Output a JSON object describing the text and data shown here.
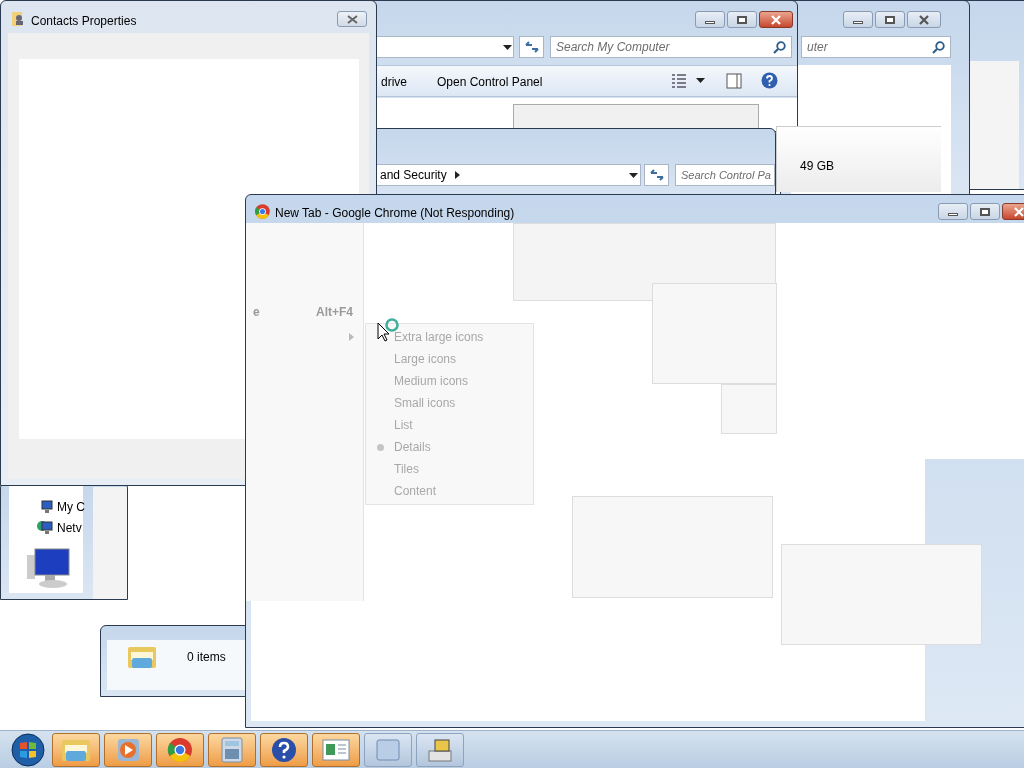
{
  "back_window": {
    "search_placeholder": "uter"
  },
  "explorer_window": {
    "search_placeholder": "Search My Computer",
    "toolbar": [
      "drive",
      "Open Control Panel"
    ]
  },
  "control_panel_window": {
    "breadcrumb": "and Security",
    "search_placeholder": "Search Control Pa"
  },
  "drive_panel": {
    "size": "49 GB"
  },
  "contacts_window": {
    "title": "Contacts Properties"
  },
  "nav_pane": {
    "items": [
      "My C",
      "Netv"
    ]
  },
  "folder_window": {
    "status": "0 items"
  },
  "chrome_window": {
    "title": "New Tab - Google Chrome (Not Responding)"
  },
  "context_menu": {
    "item": "e",
    "shortcut": "Alt+F4"
  },
  "view_menu": {
    "items": [
      {
        "label": "Extra large icons",
        "selected": false,
        "disabled": true
      },
      {
        "label": "Large icons",
        "selected": false,
        "disabled": true
      },
      {
        "label": "Medium icons",
        "selected": false,
        "disabled": true
      },
      {
        "label": "Small icons",
        "selected": false,
        "disabled": true
      },
      {
        "label": "List",
        "selected": false,
        "disabled": true
      },
      {
        "label": "Details",
        "selected": true,
        "disabled": true
      },
      {
        "label": "Tiles",
        "selected": false,
        "disabled": true
      },
      {
        "label": "Content",
        "selected": false,
        "disabled": true
      }
    ]
  },
  "taskbar": {
    "items": [
      {
        "kind": "folder",
        "running": true
      },
      {
        "kind": "media",
        "running": true
      },
      {
        "kind": "browser",
        "running": true
      },
      {
        "kind": "calculator",
        "running": true
      },
      {
        "kind": "help",
        "running": true
      },
      {
        "kind": "document",
        "running": true
      },
      {
        "kind": "window",
        "running": false
      },
      {
        "kind": "network",
        "running": false
      }
    ]
  }
}
